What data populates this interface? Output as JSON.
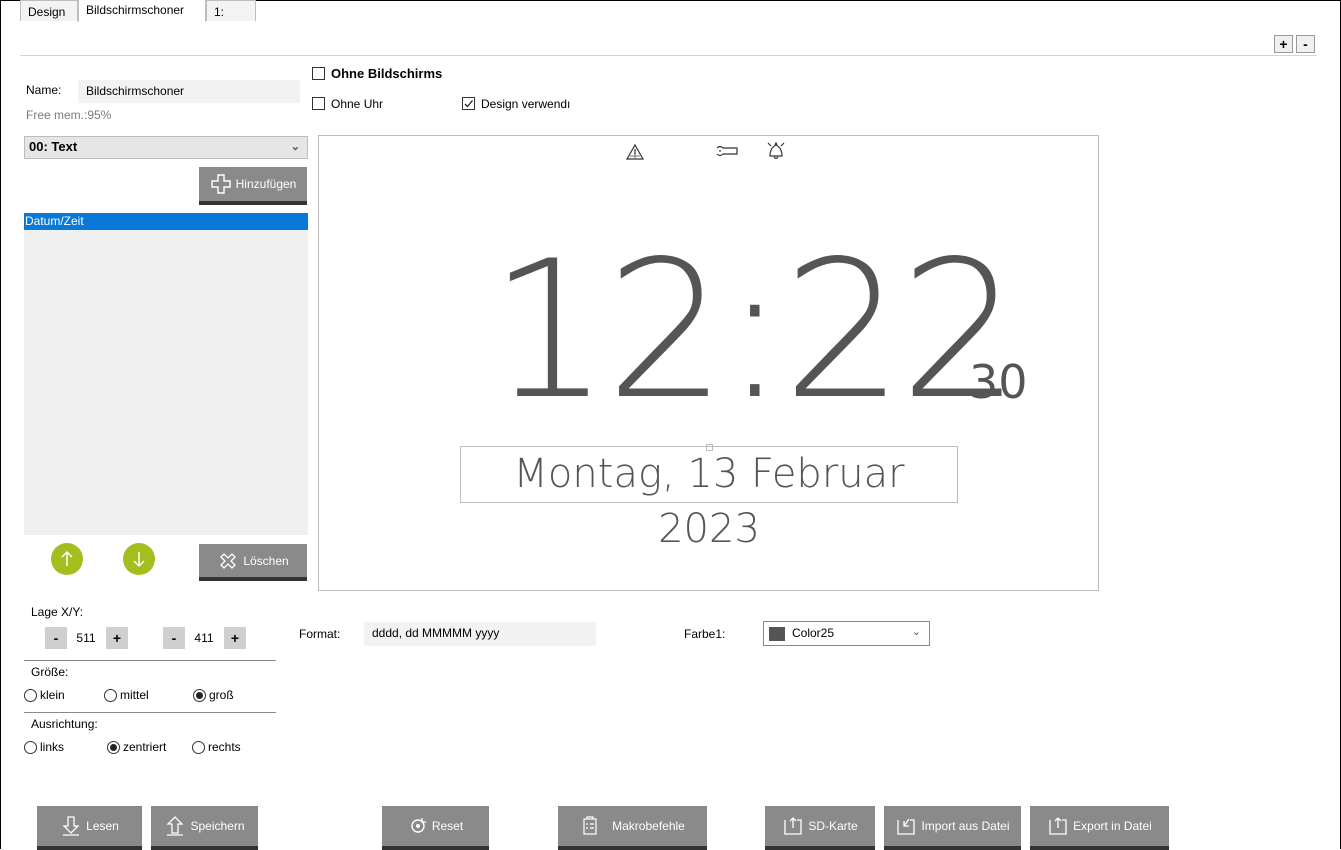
{
  "tabs": [
    {
      "label": "Design"
    },
    {
      "label": "Bildschirmschoner"
    },
    {
      "label": "1:"
    }
  ],
  "window_buttons": {
    "plus": "+",
    "minus": "-"
  },
  "name_label": "Name:",
  "name_value": "Bildschirmschoner",
  "free_mem": "Free mem.:95%",
  "options": {
    "ohne_bildschirm_label": "Ohne Bildschirms",
    "ohne_bildschirm_checked": false,
    "ohne_uhr_label": "Ohne Uhr",
    "ohne_uhr_checked": false,
    "design_verwenden_label": "Design verwendı",
    "design_verwenden_checked": true
  },
  "element_select": {
    "value": "00: Text"
  },
  "add_button": "Hinzufügen",
  "list_items": [
    "Datum/Zeit"
  ],
  "delete_button": "Löschen",
  "preview": {
    "clock_main": "12:22",
    "clock_seconds": "30",
    "date_text": "Montag, 13 Februar 2023",
    "status_icons": [
      "warning-icon",
      "wrench-icon",
      "bell-icon"
    ]
  },
  "position": {
    "label": "Lage X/Y:",
    "x": "511",
    "y": "411",
    "minus": "-",
    "plus": "+"
  },
  "size": {
    "label": "Größe:",
    "options": [
      "klein",
      "mittel",
      "groß"
    ],
    "selected": "groß"
  },
  "alignment": {
    "label": "Ausrichtung:",
    "options": [
      "links",
      "zentriert",
      "rechts"
    ],
    "selected": "zentriert"
  },
  "format": {
    "label": "Format:",
    "value": "dddd, dd MMMMM yyyy"
  },
  "color": {
    "label": "Farbe1:",
    "value": "Color25",
    "swatch": "#555555"
  },
  "bottom_buttons": {
    "lesen": "Lesen",
    "speichern": "Speichern",
    "reset": "Reset",
    "makro": "Makrobefehle",
    "sd": "SD-Karte",
    "import": "Import aus Datei",
    "export": "Export in Datei"
  }
}
